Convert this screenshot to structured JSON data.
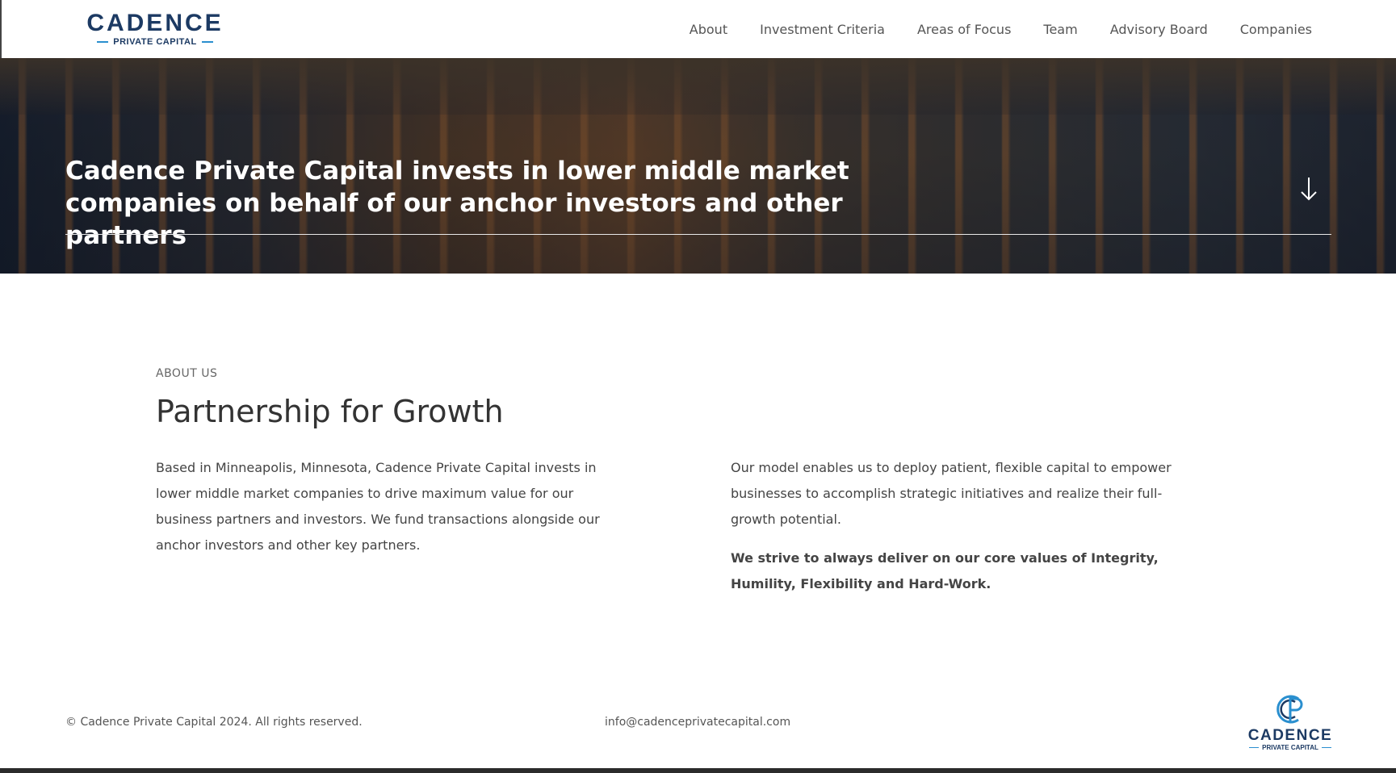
{
  "brand": {
    "logo_word": "CADENCE",
    "logo_sub": "PRIVATE CAPITAL",
    "primary_color": "#1c3a63",
    "accent_color": "#2a8fcf"
  },
  "nav": {
    "items": [
      {
        "label": "About"
      },
      {
        "label": "Investment Criteria"
      },
      {
        "label": "Areas of Focus"
      },
      {
        "label": "Team"
      },
      {
        "label": "Advisory Board"
      },
      {
        "label": "Companies"
      }
    ]
  },
  "hero": {
    "headline": "Cadence Private Capital invests in lower middle market companies on behalf of our anchor investors and other partners",
    "scroll_icon": "arrow-down-icon"
  },
  "about": {
    "kicker": "ABOUT US",
    "title": "Partnership for Growth",
    "left_paragraph": "Based in Minneapolis, Minnesota, Cadence Private Capital invests in lower middle market companies to drive maximum value for our business partners and investors. We fund transactions alongside our anchor investors and other key partners.",
    "right_paragraph": "Our model enables us to deploy patient, flexible capital to empower businesses to accomplish strategic initiatives and realize their full-growth potential.",
    "core_values": "We strive to always deliver on our core values of Integrity, Humility, Flexibility and Hard-Work."
  },
  "footer": {
    "copyright": "© Cadence Private Capital 2024. All rights reserved.",
    "email": "info@cadenceprivatecapital.com",
    "logo_word": "CADENCE",
    "logo_sub": "PRIVATE CAPITAL"
  }
}
